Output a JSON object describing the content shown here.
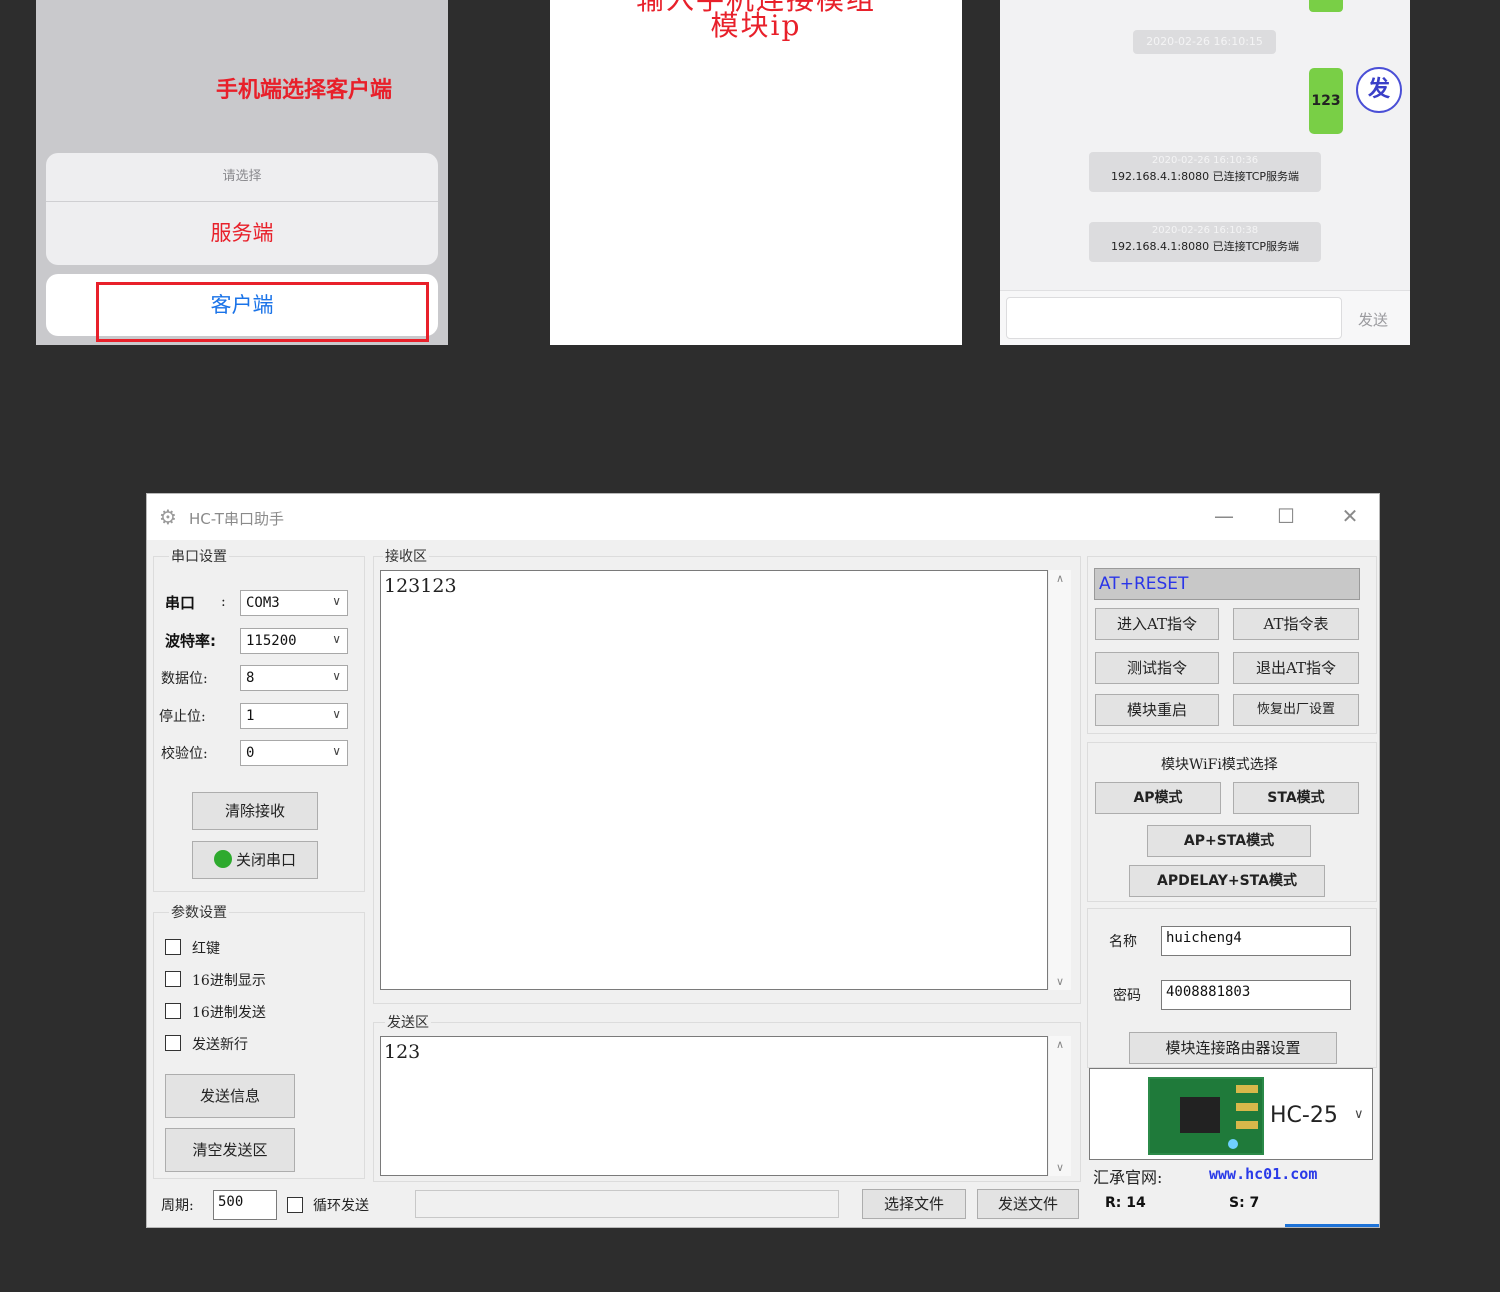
{
  "phone1": {
    "caption": "手机端选择客户端",
    "sheet_title": "请选择",
    "option_server": "服务端",
    "option_client": "客户端"
  },
  "phone2": {
    "line1": "输入手机连接模组",
    "line2": "模块ip"
  },
  "phone3": {
    "time1": "2020-02-26 16:10:15",
    "bubble_text": "123",
    "avatar_text": "发",
    "system_messages": [
      {
        "time": "2020-02-26 16:10:36",
        "text": "192.168.4.1:8080 已连接TCP服务端"
      },
      {
        "time": "2020-02-26 16:10:38",
        "text": "192.168.4.1:8080 已连接TCP服务端"
      }
    ],
    "send_label": "发送"
  },
  "window": {
    "title": "HC-T串口助手",
    "controls": {
      "minimize": "—",
      "maximize": "☐",
      "close": "✕"
    }
  },
  "serial": {
    "group_label": "串口设置",
    "port_label": "串口",
    "port_colon": ":",
    "port_value": "COM3",
    "baud_label": "波特率:",
    "baud_value": "115200",
    "databits_label": "数据位:",
    "databits_value": "8",
    "stopbits_label": "停止位:",
    "stopbits_value": "1",
    "parity_label": "校验位:",
    "parity_value": "0",
    "clear_recv_label": "清除接收",
    "close_port_label": "关闭串口",
    "status_color": "#2eaa2e"
  },
  "params": {
    "group_label": "参数设置",
    "checkboxes": [
      "红键",
      "16进制显示",
      "16进制发送",
      "发送新行"
    ],
    "send_msg_label": "发送信息",
    "clear_send_label": "清空发送区"
  },
  "receive": {
    "group_label": "接收区",
    "content": "123123"
  },
  "send": {
    "group_label": "发送区",
    "content": "123"
  },
  "bottom": {
    "period_label": "周期:",
    "period_value": "500",
    "loop_send_label": "循环发送",
    "select_file_label": "选择文件",
    "send_file_label": "发送文件",
    "rx_label": "R: 14",
    "tx_label": "S: 7"
  },
  "at": {
    "command_value": "AT+RESET",
    "enter_at_label": "进入AT指令",
    "at_list_label": "AT指令表",
    "test_label": "测试指令",
    "exit_at_label": "退出AT指令",
    "restart_label": "模块重启",
    "factory_reset_label": "恢复出厂设置"
  },
  "wifi": {
    "group_label": "模块WiFi模式选择",
    "ap_label": "AP模式",
    "sta_label": "STA模式",
    "apsta_label": "AP+STA模式",
    "apdelay_label": "APDELAY+STA模式"
  },
  "router": {
    "name_label": "名称",
    "name_value": "huicheng4",
    "password_label": "密码",
    "password_value": "4008881803",
    "connect_label": "模块连接路由器设置"
  },
  "module": {
    "model_value": "HC-25",
    "site_label": "汇承官网:",
    "site_link": "www.hc01.com"
  }
}
